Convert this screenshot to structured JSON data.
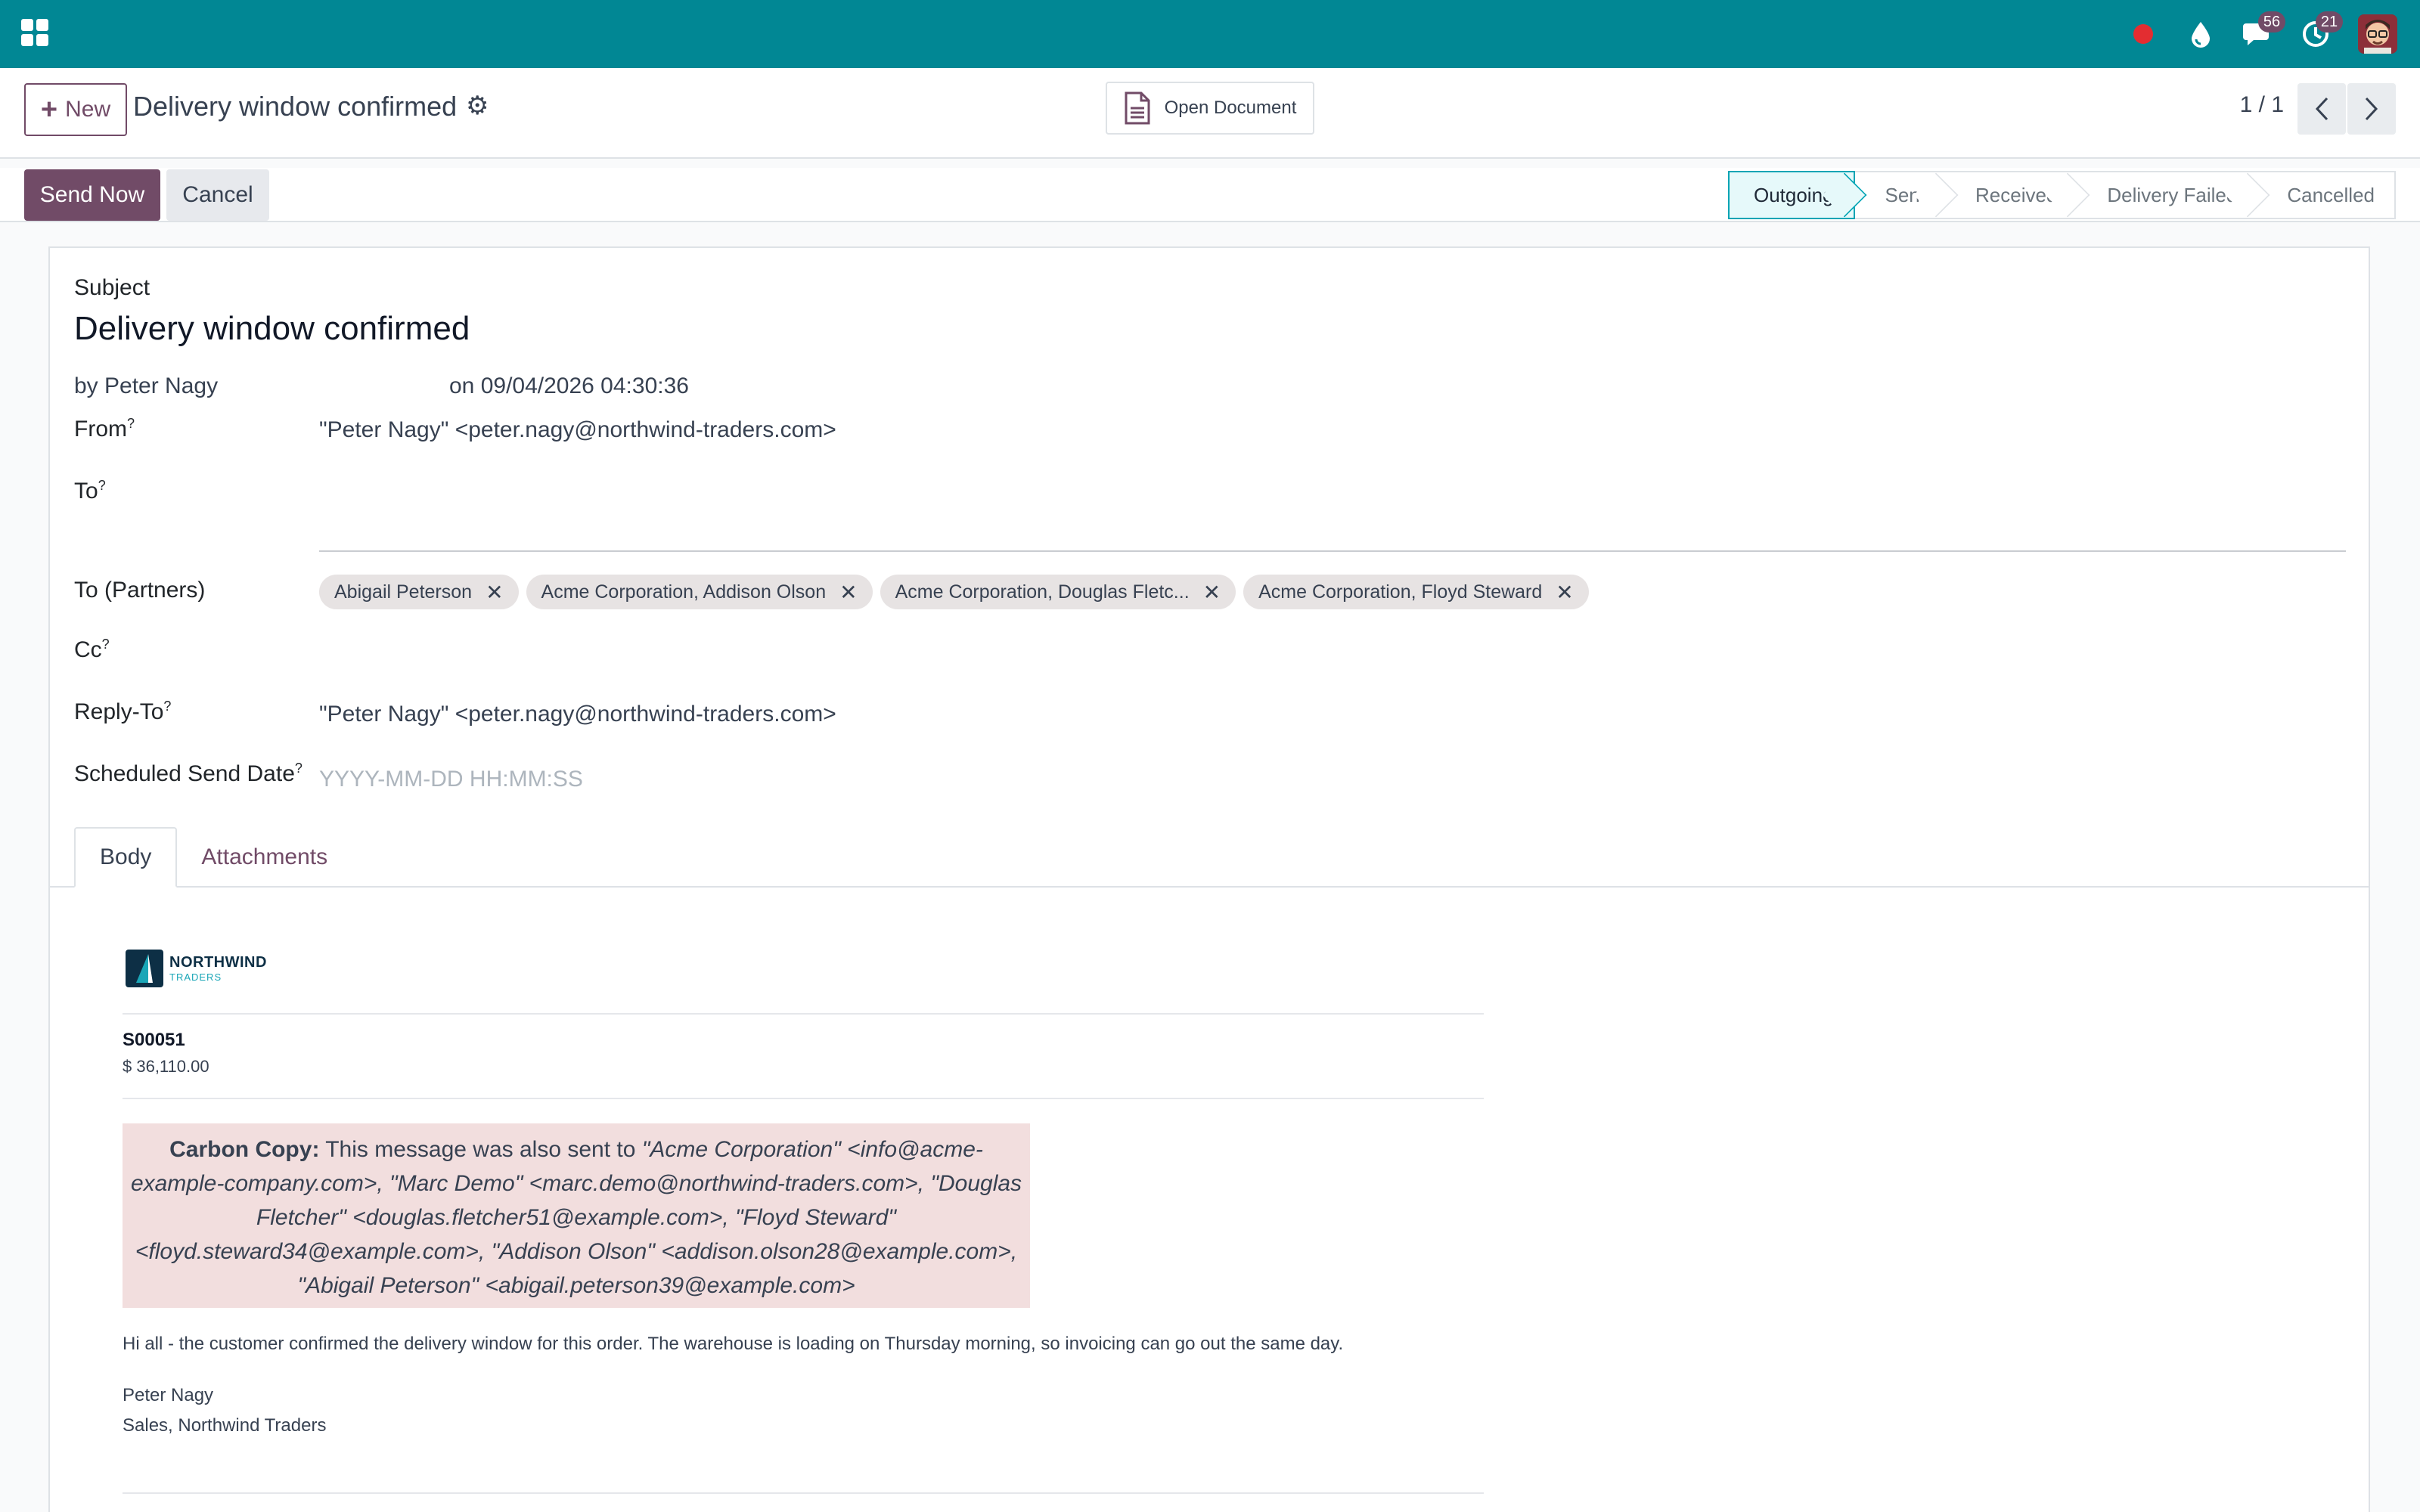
{
  "navbar": {
    "chat_count": "56",
    "activity_count": "21",
    "color": "#018794"
  },
  "control": {
    "new_label": "New",
    "record_title": "Delivery window confirmed",
    "open_document_label": "Open Document",
    "pager": "1 / 1"
  },
  "actions": {
    "send_now_label": "Send Now",
    "cancel_label": "Cancel"
  },
  "stages": [
    {
      "label": "Outgoing",
      "active": true
    },
    {
      "label": "Sent",
      "active": false
    },
    {
      "label": "Received",
      "active": false
    },
    {
      "label": "Delivery Failed",
      "active": false
    },
    {
      "label": "Cancelled",
      "active": false
    }
  ],
  "form": {
    "subject_label": "Subject",
    "subject_value": "Delivery window confirmed",
    "author": "by Peter Nagy",
    "date": "on 09/04/2026 04:30:36",
    "from_label": "From",
    "from_value": "\"Peter Nagy\" <peter.nagy@northwind-traders.com>",
    "to_label": "To",
    "to_partners_label": "To (Partners)",
    "partners": [
      "Abigail Peterson",
      "Acme Corporation, Addison Olson",
      "Acme Corporation, Douglas Fletc...",
      "Acme Corporation, Floyd Steward"
    ],
    "cc_label": "Cc",
    "reply_to_label": "Reply-To",
    "reply_to_value": "\"Peter Nagy\" <peter.nagy@northwind-traders.com>",
    "scheduled_label": "Scheduled Send Date",
    "scheduled_placeholder": "YYYY-MM-DD HH:MM:SS",
    "help_mark": "?"
  },
  "tabs": {
    "body": "Body",
    "attachments": "Attachments"
  },
  "email": {
    "logo_name": "NORTHWIND",
    "logo_sub": "TRADERS",
    "order_ref": "S00051",
    "order_amount": "$ 36,110.00",
    "cc_heading": "Carbon Copy:",
    "cc_intro": "This message was also sent to",
    "cc_recipients": "\"Acme Corporation\" <info@acme-example-company.com>, \"Marc Demo\" <marc.demo@northwind-traders.com>, \"Douglas Fletcher\" <douglas.fletcher51@example.com>, \"Floyd Steward\" <floyd.steward34@example.com>, \"Addison Olson\" <addison.olson28@example.com>, \"Abigail Peterson\" <abigail.peterson39@example.com>",
    "message": "Hi all - the customer confirmed the delivery window for this order. The warehouse is loading on Thursday morning, so invoicing can go out the same day.",
    "signature_name": "Peter Nagy",
    "signature_title": "Sales, Northwind Traders"
  }
}
